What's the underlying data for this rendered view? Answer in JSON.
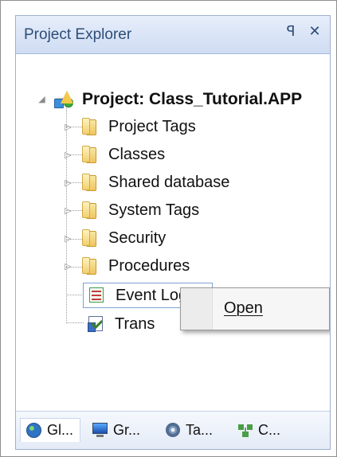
{
  "panel": {
    "title": "Project Explorer",
    "pin_glyph": "ꟼ",
    "close_glyph": "✕"
  },
  "tree": {
    "project_label": "Project: Class_Tutorial.APP",
    "items": [
      {
        "label": "Project Tags",
        "icon": "folder-icon"
      },
      {
        "label": "Classes",
        "icon": "folder-icon"
      },
      {
        "label": "Shared database",
        "icon": "folder-icon"
      },
      {
        "label": "System Tags",
        "icon": "folder-icon"
      },
      {
        "label": "Security",
        "icon": "folder-icon"
      },
      {
        "label": "Procedures",
        "icon": "folder-icon"
      }
    ],
    "selected_item": {
      "label": "Event Logger",
      "icon": "event-logger-icon"
    },
    "partial_item": {
      "label": "Trans",
      "icon": "transactions-icon"
    }
  },
  "context_menu": {
    "items": [
      {
        "label": "Open"
      }
    ]
  },
  "bottom_tabs": [
    {
      "label": "Gl...",
      "icon": "globe-icon"
    },
    {
      "label": "Gr...",
      "icon": "graphics-icon"
    },
    {
      "label": "Ta...",
      "icon": "tasks-icon"
    },
    {
      "label": "C...",
      "icon": "comm-icon"
    }
  ],
  "colors": {
    "title_text": "#2d4d77",
    "panel_border": "#9fb0cc",
    "title_bg_top": "#e7eefb",
    "title_bg_bottom": "#cfdcf3",
    "selection_border": "#7da2ce"
  }
}
